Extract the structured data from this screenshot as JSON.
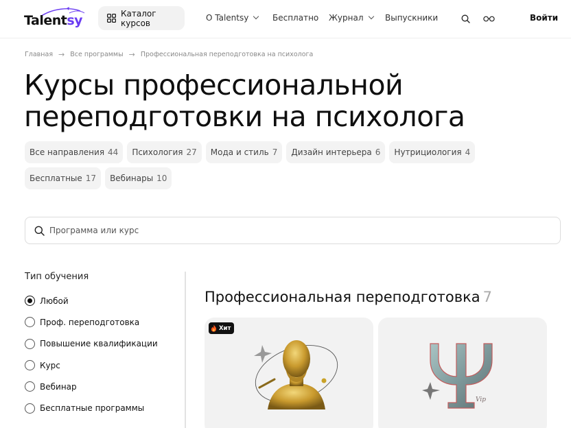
{
  "header": {
    "logo_main": "Talent",
    "logo_accent": "sy",
    "catalog_label": "Каталог курсов",
    "nav": [
      {
        "label": "О Talentsy",
        "has_dropdown": true
      },
      {
        "label": "Бесплатно",
        "has_dropdown": false
      },
      {
        "label": "Журнал",
        "has_dropdown": true
      },
      {
        "label": "Выпускники",
        "has_dropdown": false
      }
    ],
    "search_icon": "search-icon",
    "glasses_icon": "glasses-icon",
    "login_label": "Войти"
  },
  "breadcrumb": [
    "Главная",
    "Все программы",
    "Профессиональная переподготовка на психолога"
  ],
  "page_title": "Курсы профессиональной переподготовки на психолога",
  "chips": [
    {
      "label": "Все направления",
      "count": "44"
    },
    {
      "label": "Психология",
      "count": "27"
    },
    {
      "label": "Мода и стиль",
      "count": "7"
    },
    {
      "label": "Дизайн интерьера",
      "count": "6"
    },
    {
      "label": "Нутрициология",
      "count": "4"
    },
    {
      "label": "Бесплатные",
      "count": "17"
    },
    {
      "label": "Вебинары",
      "count": "10"
    }
  ],
  "search": {
    "placeholder": "Программа или курс",
    "value": ""
  },
  "filters": {
    "title": "Тип обучения",
    "options": [
      "Любой",
      "Проф. переподготовка",
      "Повышение квалификации",
      "Курс",
      "Вебинар",
      "Бесплатные программы"
    ],
    "selected": "Любой"
  },
  "section": {
    "title": "Профессиональная переподготовка",
    "count": "7"
  },
  "cards": [
    {
      "badge": "Хит",
      "image_icon": "freud-bust-icon"
    },
    {
      "badge": "",
      "image_icon": "psi-vip-icon"
    }
  ],
  "colors": {
    "accent": "#6a3cf2",
    "chip_bg": "#f3f3f3",
    "card_bg": "#f2f2f2",
    "gold": "#c9a227"
  }
}
